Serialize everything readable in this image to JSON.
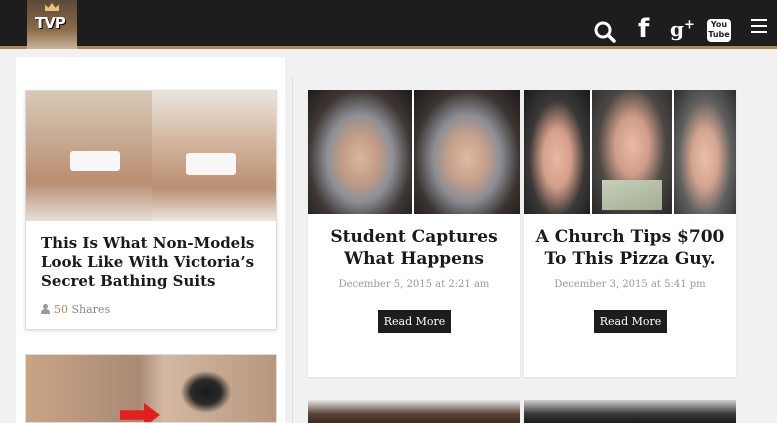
{
  "header": {
    "logo_text": "TVP",
    "icons": [
      "search-icon",
      "facebook-icon",
      "google-plus-icon",
      "youtube-icon",
      "menu-icon"
    ],
    "youtube_label_top": "You",
    "youtube_label_bottom": "Tube"
  },
  "left": {
    "featured": {
      "title": "This Is What Non-Models Look Like With Victoria’s Secret Bathing Suits",
      "shares_count": "50",
      "shares_label": "Shares"
    }
  },
  "articles": [
    {
      "title": "Student Captures What Happens",
      "date": "December 5, 2015 at 2:21 am",
      "button": "Read More"
    },
    {
      "title": "A Church Tips $700 To This Pizza Guy.",
      "date": "December 3, 2015 at 5:41 pm",
      "button": "Read More"
    }
  ],
  "colors": {
    "header_bg": "#1d1d1d",
    "accent": "#b08a55",
    "button_bg": "#1d1d1d"
  }
}
